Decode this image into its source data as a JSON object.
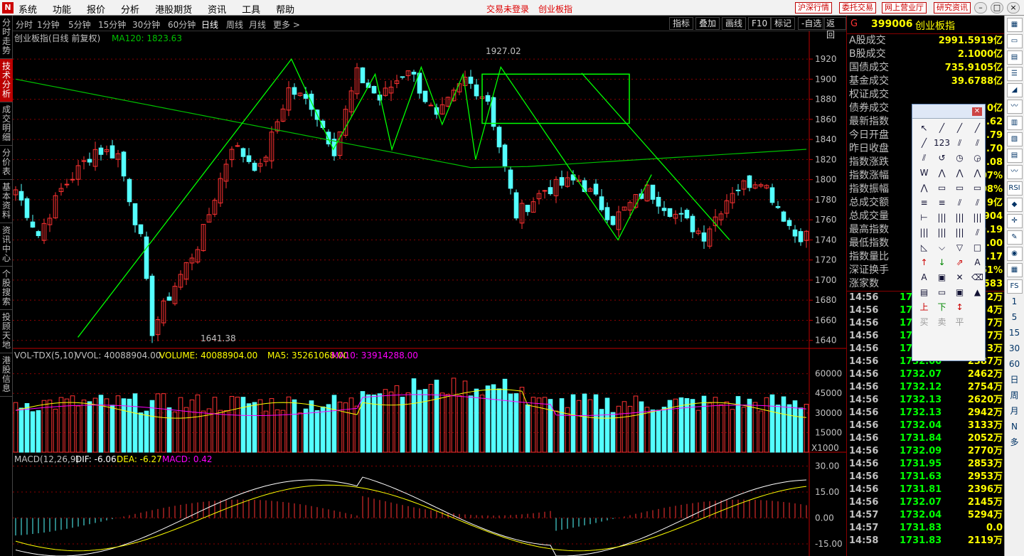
{
  "menubar": {
    "items": [
      "系统",
      "功能",
      "报价",
      "分析",
      "港股期货",
      "资讯",
      "工具",
      "帮助"
    ],
    "status": [
      "交易未登录",
      "创业板指"
    ],
    "buttons": [
      "沪深行情",
      "委托交易",
      "网上营业厅",
      "研究资讯"
    ]
  },
  "left_tabs": [
    {
      "label": "分时走势",
      "active": false
    },
    {
      "label": "技术分析",
      "active": true
    },
    {
      "label": "成交明细",
      "active": false
    },
    {
      "label": "分价表",
      "active": false
    },
    {
      "label": "基本资料",
      "active": false
    },
    {
      "label": "资讯中心",
      "active": false
    },
    {
      "label": "个股搜索",
      "active": false
    },
    {
      "label": "投顾天地",
      "active": false
    },
    {
      "label": "港股信息",
      "active": false
    }
  ],
  "periods": {
    "items": [
      "分时",
      "1分钟",
      "5分钟",
      "15分钟",
      "30分钟",
      "60分钟",
      "日线",
      "周线",
      "月线",
      "更多 >"
    ],
    "active": "日线"
  },
  "right_tools": [
    "指标",
    "叠加",
    "画线",
    "F10",
    "标记",
    "-自选",
    "返回"
  ],
  "chart_data": {
    "type": "candlestick",
    "title": "创业板指(日线 前复权)",
    "ma120_label": "MA120: 1823.63",
    "annotations": {
      "high": "1927.02",
      "low": "1641.38"
    },
    "price_ticks": [
      "1920",
      "1900",
      "1880",
      "1860",
      "1840",
      "1820",
      "1800",
      "1780",
      "1760",
      "1740",
      "1720",
      "1700",
      "1680",
      "1660",
      "1640"
    ],
    "ylim": [
      1632,
      1942
    ],
    "volume": {
      "header": [
        "VOL-TDX(5,10)",
        "VVOL: 40088904.00",
        "VOLUME: 40088904.00",
        "MA5: 35261068.00",
        "MA10: 33914288.00"
      ],
      "ticks": [
        "60000",
        "45000",
        "30000",
        "15000"
      ],
      "unit": "X1000",
      "ylim": [
        0,
        75000
      ]
    },
    "macd": {
      "header": [
        "MACD(12,26,9)",
        "DIF: -6.06",
        "DEA: -6.27",
        "MACD: 0.42"
      ],
      "ticks": [
        "30.00",
        "15.00",
        "0.00",
        "-15.00"
      ],
      "ylim": [
        -22,
        38
      ]
    }
  },
  "quote": {
    "code": "399006",
    "name": "创业板指",
    "g": "G",
    "rows": [
      {
        "l": "A股成交",
        "v": "2991.5919亿"
      },
      {
        "l": "B股成交",
        "v": "2.1000亿"
      },
      {
        "l": "国债成交",
        "v": "735.9105亿"
      },
      {
        "l": "基金成交",
        "v": "39.6788亿"
      },
      {
        "l": "权证成交",
        "v": ""
      },
      {
        "l": "债券成交",
        "v": "0亿"
      },
      {
        "l": "最新指数",
        "v": "2.62"
      },
      {
        "l": "今日开盘",
        "v": "8.79"
      },
      {
        "l": "昨日收盘",
        "v": "8.70"
      },
      {
        "l": "指数涨跌",
        "v": "3.08"
      },
      {
        "l": "指数涨幅",
        "v": "07%"
      },
      {
        "l": "指数振幅",
        "v": "08%"
      },
      {
        "l": "总成交额",
        "v": "9亿"
      },
      {
        "l": "总成交量",
        "v": "904"
      },
      {
        "l": "最高指数",
        "v": "0.19"
      },
      {
        "l": "最低指数",
        "v": "2.00"
      },
      {
        "l": "指数量比",
        "v": ".17"
      },
      {
        "l": "深证换手",
        "v": "61%"
      },
      {
        "l": "涨家数",
        "v": "583"
      }
    ],
    "ticks": [
      {
        "t": "14:56",
        "p": "17",
        "q": "2万"
      },
      {
        "t": "14:56",
        "p": "17",
        "q": "4万"
      },
      {
        "t": "14:56",
        "p": "17",
        "q": "7万"
      },
      {
        "t": "14:56",
        "p": "17",
        "q": "7万"
      },
      {
        "t": "14:56",
        "p": "17",
        "q": "3万"
      },
      {
        "t": "14:56",
        "p": "1732.00",
        "q": "2387万"
      },
      {
        "t": "14:56",
        "p": "1732.07",
        "q": "2462万"
      },
      {
        "t": "14:56",
        "p": "1732.12",
        "q": "2754万"
      },
      {
        "t": "14:56",
        "p": "1732.13",
        "q": "2620万"
      },
      {
        "t": "14:56",
        "p": "1732.13",
        "q": "2942万"
      },
      {
        "t": "14:56",
        "p": "1732.04",
        "q": "3133万"
      },
      {
        "t": "14:56",
        "p": "1731.84",
        "q": "2052万"
      },
      {
        "t": "14:56",
        "p": "1732.09",
        "q": "2770万"
      },
      {
        "t": "14:56",
        "p": "1731.95",
        "q": "2853万"
      },
      {
        "t": "14:56",
        "p": "1731.63",
        "q": "2953万"
      },
      {
        "t": "14:56",
        "p": "1731.81",
        "q": "2396万"
      },
      {
        "t": "14:56",
        "p": "1732.07",
        "q": "2145万"
      },
      {
        "t": "14:57",
        "p": "1732.04",
        "q": "5294万"
      },
      {
        "t": "14:57",
        "p": "1731.83",
        "q": "0.0"
      },
      {
        "t": "14:58",
        "p": "1731.83",
        "q": "2119万"
      }
    ]
  },
  "drawing_tools": {
    "items": [
      "↖",
      "╱",
      "╱",
      "╱",
      "╱",
      "123",
      "⫽",
      "⫽",
      "⫽",
      "↺",
      "◷",
      "◶",
      "W",
      "⋀",
      "⋀",
      "⋀",
      "⋀",
      "▭",
      "▭",
      "▭",
      "≡",
      "≡",
      "⫽",
      "⫽",
      "⊢",
      "|||",
      "|||",
      "|||",
      "|||",
      "|||",
      "|||",
      "⫽",
      "◺",
      "⌵",
      "▽",
      "□",
      "↑",
      "↓",
      "⇗",
      "A",
      "A",
      "▣",
      "✕",
      "⌫",
      "▤",
      "▭",
      "▣",
      "▲",
      "上",
      "下",
      "↕",
      ""
    ],
    "trade": [
      "买",
      "卖",
      "平"
    ]
  },
  "side_icons": [
    "▦",
    "▭",
    "▤",
    "☰",
    "◢",
    "〰",
    "▥",
    "▧",
    "▤",
    "〰",
    "RSI",
    "◆",
    "✛",
    "✎",
    "◉",
    "▦",
    "FS"
  ],
  "side_nums": [
    "1",
    "5",
    "15",
    "30",
    "60",
    "日",
    "周",
    "月",
    "N",
    "多"
  ],
  "colors": {
    "up": "#ff3232",
    "down": "#54ffff",
    "ma120": "#00c000",
    "ma5": "#ffffff",
    "ma10": "#ffff00",
    "ma20": "#ff00ff",
    "grid": "#8b0000",
    "trend": "#00ff00",
    "axis": "#c00000"
  }
}
